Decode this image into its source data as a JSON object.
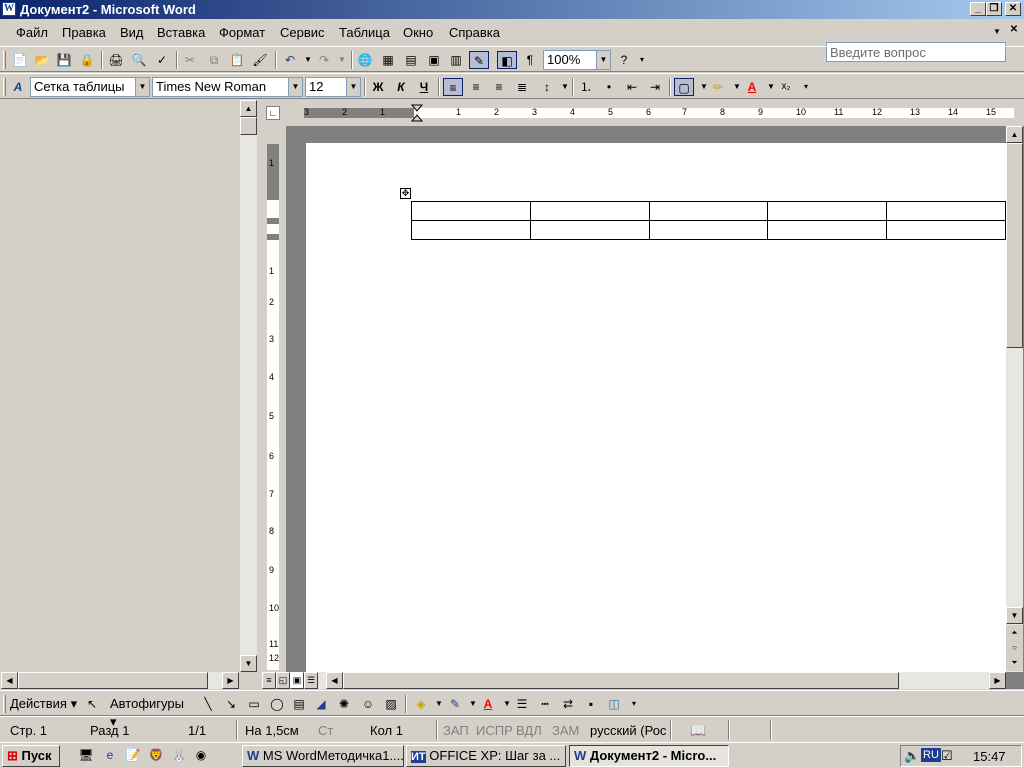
{
  "window": {
    "title": "Документ2 - Microsoft Word",
    "app_icon": "W"
  },
  "menu": [
    "Файл",
    "Правка",
    "Вид",
    "Вставка",
    "Формат",
    "Сервис",
    "Таблица",
    "Окно",
    "Справка"
  ],
  "help": {
    "placeholder": "Введите вопрос"
  },
  "standard": {
    "zoom": "100%"
  },
  "formatting": {
    "style": "Сетка таблицы",
    "font": "Times New Roman",
    "size": "12",
    "bold": "Ж",
    "italic": "К",
    "underline": "Ч"
  },
  "hruler": {
    "labels": [
      "3",
      "2",
      "1",
      "1",
      "2",
      "3",
      "4",
      "5",
      "6",
      "7",
      "8",
      "9",
      "10",
      "11",
      "12",
      "13",
      "14",
      "15"
    ]
  },
  "vruler": {
    "labels": [
      "1",
      "1",
      "2",
      "3",
      "4",
      "5",
      "6",
      "7",
      "8",
      "9",
      "10",
      "11",
      "12"
    ]
  },
  "document": {
    "table": {
      "rows": 2,
      "cols": 5
    }
  },
  "drawing": {
    "actions": "Действия",
    "autoshapes": "Автофигуры"
  },
  "status": {
    "page": "Стр.  1",
    "section": "Разд  1",
    "pages": "1/1",
    "at": "На  1,5см",
    "line": "Ст",
    "col": "Кол  1",
    "rec": "ЗАП",
    "trk": "ИСПР",
    "ext": "ВДЛ",
    "ovr": "ЗАМ",
    "lang": "русский (Рос"
  },
  "taskbar": {
    "start": "Пуск",
    "tasks": [
      "MS WordМетодичка1....",
      "OFFICE XP: Шаг за ...",
      "Документ2 - Micro..."
    ],
    "lang": "RU",
    "clock": "15:47"
  }
}
